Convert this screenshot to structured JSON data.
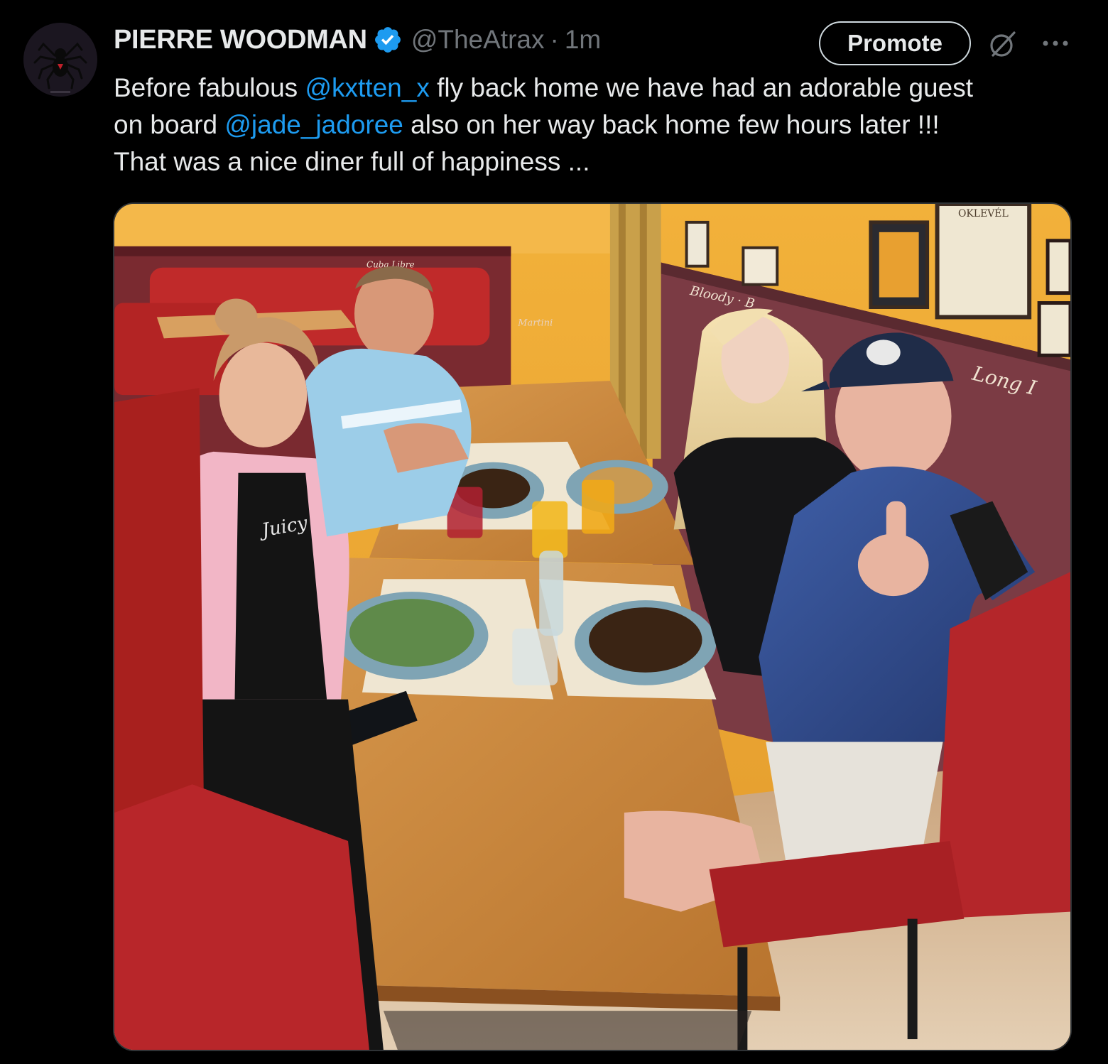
{
  "author": {
    "display_name": "PIERRE WOODMAN",
    "handle": "@TheAtrax",
    "separator": "·",
    "time": "1m",
    "verified_icon": "verified-badge-icon",
    "avatar_icon": "spider-avatar"
  },
  "actions": {
    "promote_label": "Promote",
    "grok_icon": "grok-icon",
    "more_icon": "more-icon"
  },
  "tweet": {
    "line1_a": "Before fabulous ",
    "line1_mention": "@kxtten_x",
    "line1_b": " fly back home we have had  an adorable guest",
    "line2_a": "on board ",
    "line2_mention": "@jade_jadoree",
    "line2_b": " also on her way back home few hours later !!!",
    "line3": "That was a nice diner full of happiness ..."
  },
  "media": {
    "type": "photo",
    "wall_texts": {
      "diploma": "OKLEVÉL",
      "script_bloody": "Bloody · B",
      "script_long": "Long I",
      "script_cuba": "Cuba Libre",
      "script_martini": "Martini",
      "shirt_text": "Juicy"
    }
  },
  "colors": {
    "background": "#000000",
    "text": "#e7e9ea",
    "secondary": "#71767b",
    "link": "#1d9bf0",
    "verified": "#1d9bf0"
  }
}
